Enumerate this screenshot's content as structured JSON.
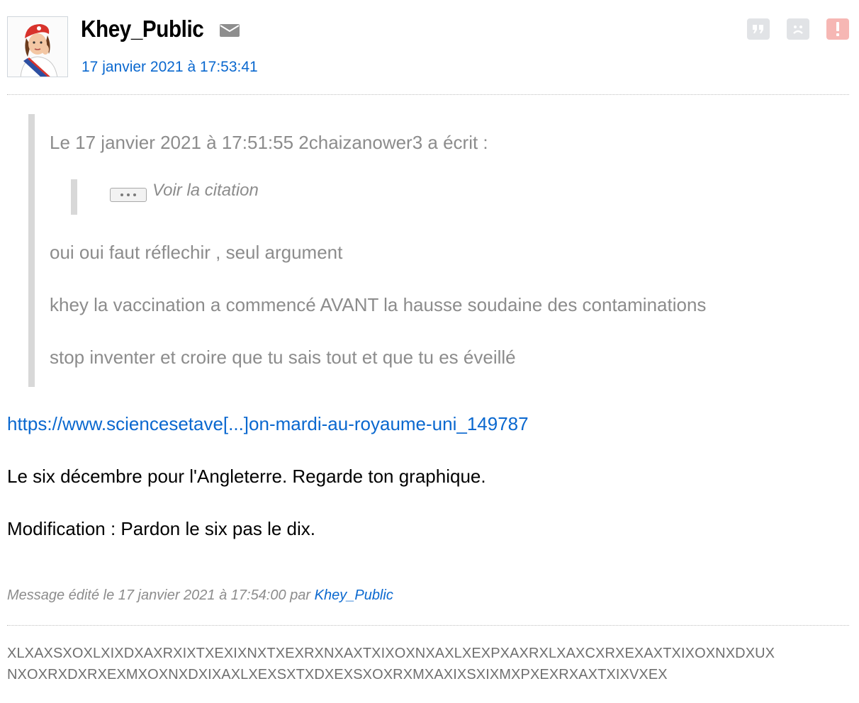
{
  "author": {
    "pseudo": "Khey_Public",
    "date": "17 janvier 2021 à 17:53:41",
    "avatar_icon": "marianne-avatar-icon",
    "mail_icon": "envelope-icon"
  },
  "actions": [
    {
      "icon": "quote-icon",
      "color": "#e1e3e6"
    },
    {
      "icon": "sad-face-icon",
      "color": "#e1e3e6"
    },
    {
      "icon": "report-alert-icon",
      "color": "#f6b7b4"
    }
  ],
  "quote": {
    "header": "Le 17 janvier 2021 à 17:51:55 2chaizanower3 a écrit :",
    "nested_label": "Voir la citation",
    "lines": [
      "oui oui faut réflechir , seul argument",
      "khey la vaccination a commencé AVANT la hausse soudaine des contaminations",
      "stop inventer et croire que tu sais tout et que tu es éveillé"
    ]
  },
  "message": {
    "link": "https://www.sciencesetave[...]on-mardi-au-royaume-uni_149787",
    "line1": "Le six décembre pour l'Angleterre. Regarde ton graphique.",
    "line2": "Modification : Pardon le six pas le dix."
  },
  "edited": {
    "prefix": "Message édité le 17 janvier 2021 à 17:54:00 par ",
    "by": "Khey_Public"
  },
  "signature": [
    "XLXAXSXOXLXIXDXAXRXIXTXEXIXNXTXEXRXNXAXTXIXOXNXAXLXEXPXAXRXLXAXCXRXEXAXTXIXOXNXDXUX",
    "NXOXRXDXRXEXMXOXNXDXIXAXLXEXSXTXDXEXSXOXRXMXAXIXSXIXMXPXEXRXAXTXIXVXEX"
  ],
  "colors": {
    "link": "#0a68cf",
    "quote_text": "#8c8c8c",
    "quote_bar": "#d8d8d8"
  }
}
